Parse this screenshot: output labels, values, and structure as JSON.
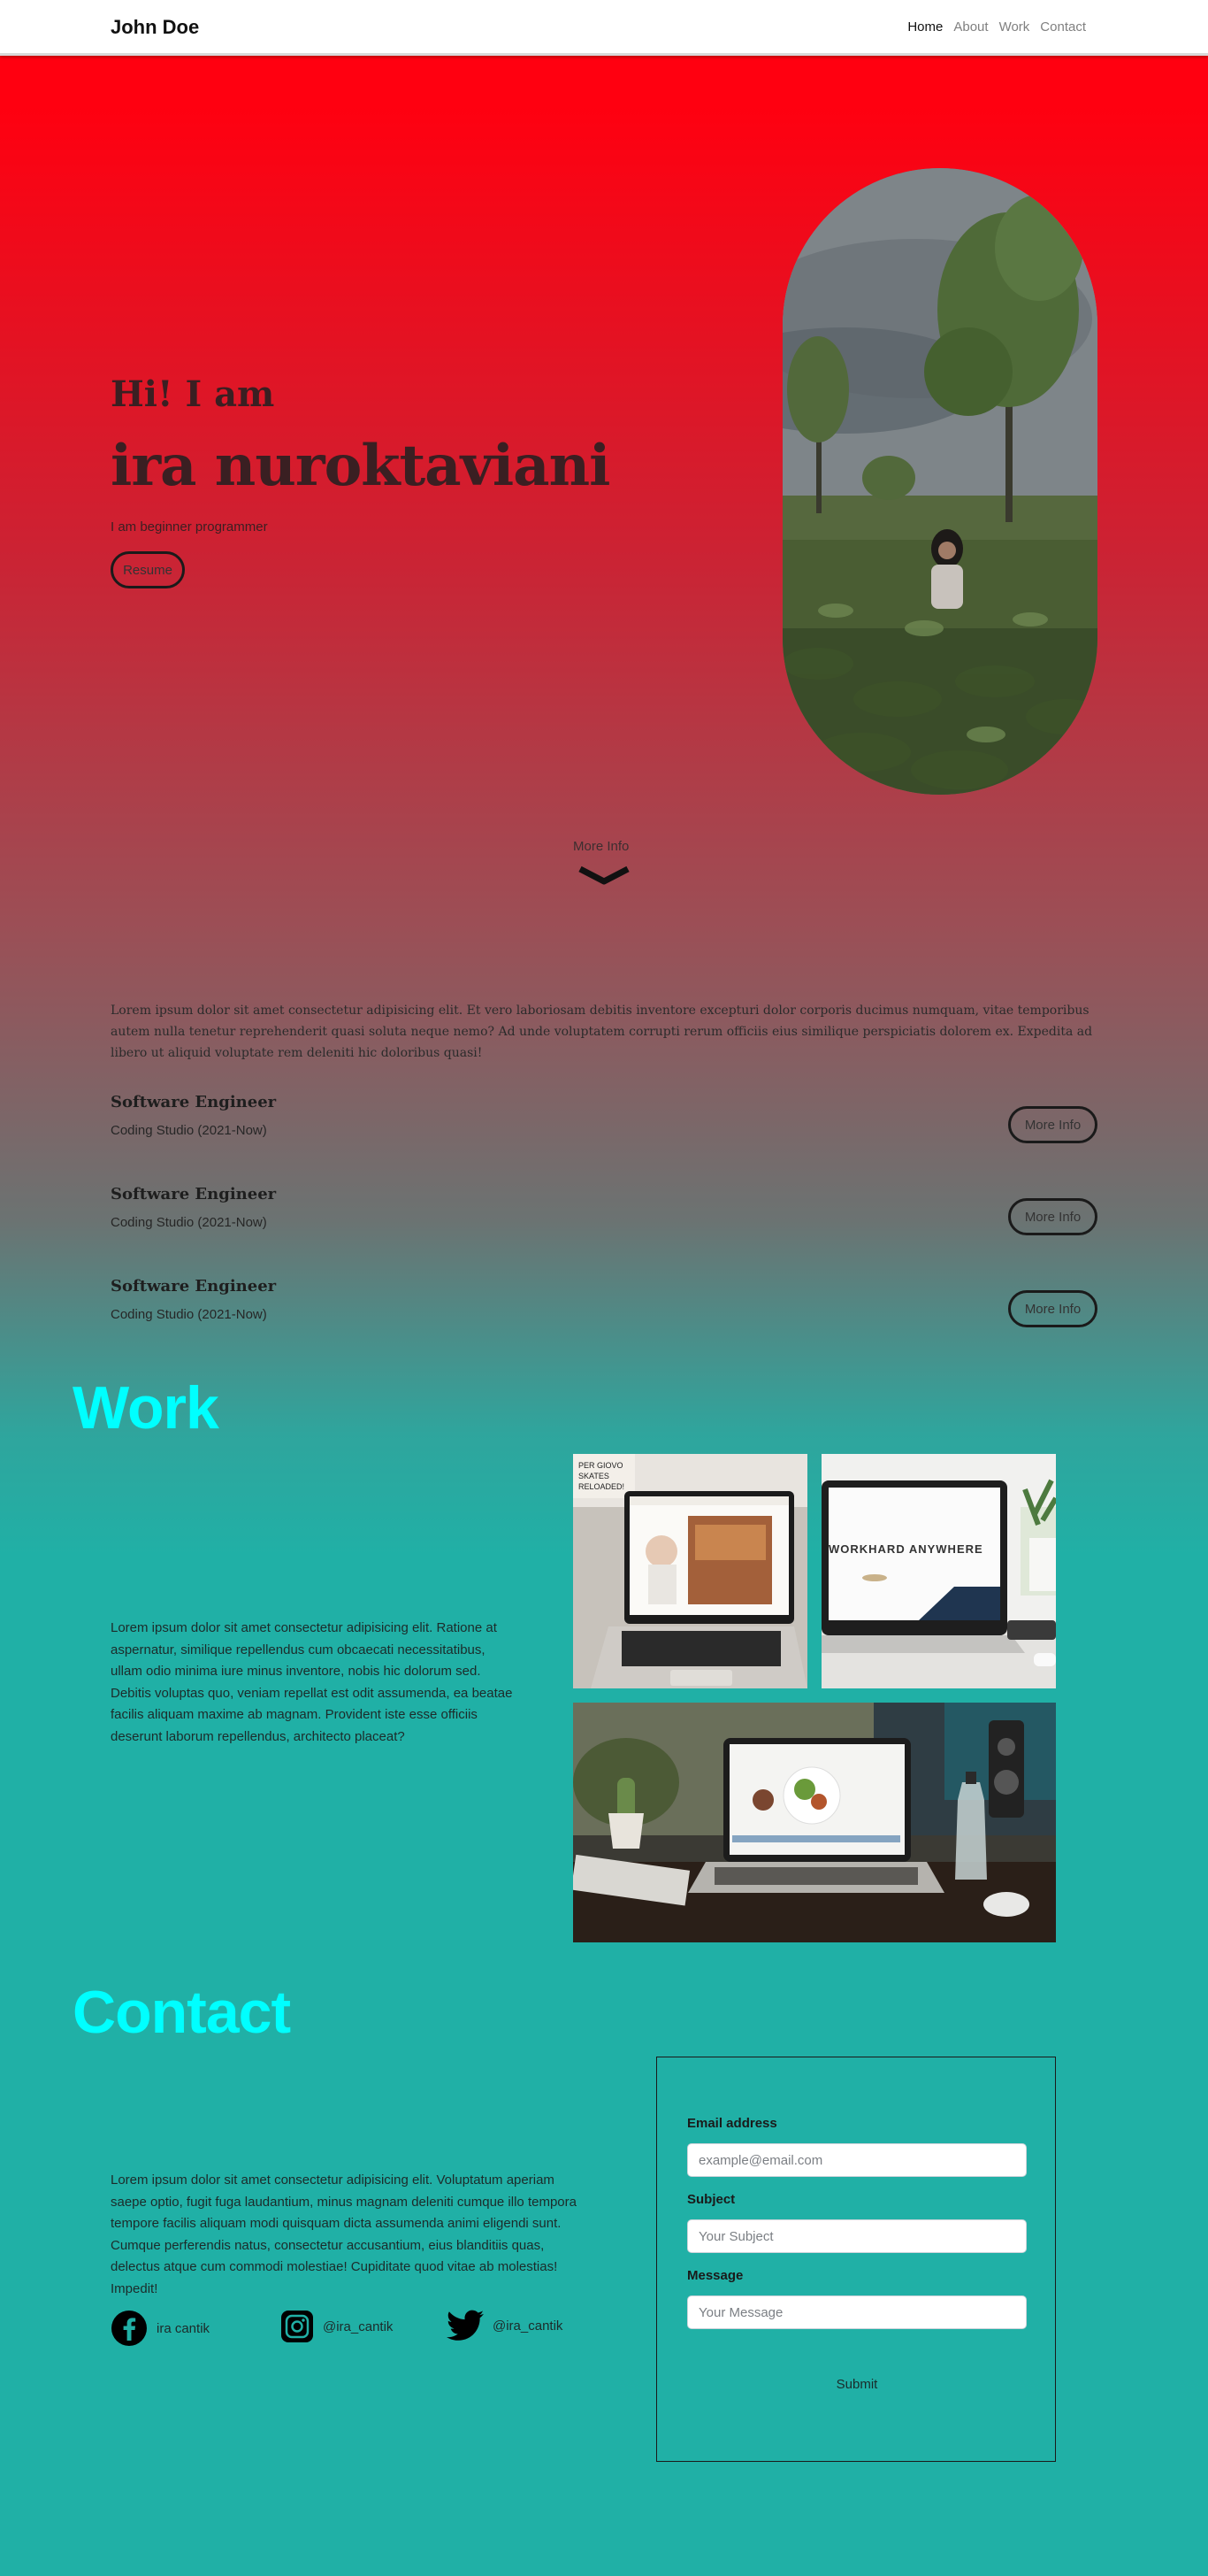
{
  "navbar": {
    "brand": "John Doe",
    "links": [
      {
        "label": "Home",
        "active": true
      },
      {
        "label": "About",
        "active": false
      },
      {
        "label": "Work",
        "active": false
      },
      {
        "label": "Contact",
        "active": false
      }
    ]
  },
  "hero": {
    "greeting": "Hi! I am",
    "name": "ira nuroktaviani",
    "subtitle": "I am beginner programmer",
    "resume_label": "Resume",
    "more_info_label": "More Info"
  },
  "about": {
    "text": "Lorem ipsum dolor sit amet consectetur adipisicing elit. Et vero laboriosam debitis inventore excepturi dolor corporis ducimus numquam, vitae temporibus autem nulla tenetur reprehenderit quasi soluta neque nemo? Ad unde voluptatem corrupti rerum officiis eius similique perspiciatis dolorem ex. Expedita ad libero ut aliquid voluptate rem deleniti hic doloribus quasi!",
    "jobs": [
      {
        "title": "Software Engineer",
        "company": "Coding Studio (2021-Now)",
        "button": "More Info"
      },
      {
        "title": "Software Engineer",
        "company": "Coding Studio (2021-Now)",
        "button": "More Info"
      },
      {
        "title": "Software Engineer",
        "company": "Coding Studio (2021-Now)",
        "button": "More Info"
      }
    ]
  },
  "work": {
    "heading": "Work",
    "text": "Lorem ipsum dolor sit amet consectetur adipisicing elit. Ratione at aspernatur, similique repellendus cum obcaecati necessitatibus, ullam odio minima iure minus inventore, nobis hic dolorum sed. Debitis voluptas quo, veniam repellat est odit assumenda, ea beatae facilis aliquam maxime ab magnam. Provident iste esse officiis deserunt laborum repellendus, architecto placeat?",
    "images": [
      {
        "name": "laptop-website-photo"
      },
      {
        "name": "laptop-workhard-photo",
        "caption": "WORKHARD ANYWHERE"
      },
      {
        "name": "laptop-desk-photo"
      }
    ]
  },
  "contact": {
    "heading": "Contact",
    "text": "Lorem ipsum dolor sit amet consectetur adipisicing elit. Voluptatum aperiam saepe optio, fugit fuga laudantium, minus magnam deleniti cumque illo tempora tempore facilis aliquam modi quisquam dicta assumenda animi eligendi sunt. Cumque perferendis natus, consectetur accusantium, eius blanditiis quas, delectus atque cum commodi molestiae! Cupiditate quod vitae ab molestias! Impedit!",
    "socials": [
      {
        "icon": "facebook-icon",
        "label": "ira cantik"
      },
      {
        "icon": "instagram-icon",
        "label": "@ira_cantik"
      },
      {
        "icon": "twitter-icon",
        "label": "@ira_cantik"
      }
    ],
    "form": {
      "email_label": "Email address",
      "email_placeholder": "example@email.com",
      "subject_label": "Subject",
      "subject_placeholder": "Your Subject",
      "message_label": "Message",
      "message_placeholder": "Your Message",
      "submit_label": "Submit"
    }
  },
  "colors": {
    "heading_accent": "#00ffff",
    "gradient_top": "#ff0010",
    "gradient_bottom": "#20b0a6"
  }
}
